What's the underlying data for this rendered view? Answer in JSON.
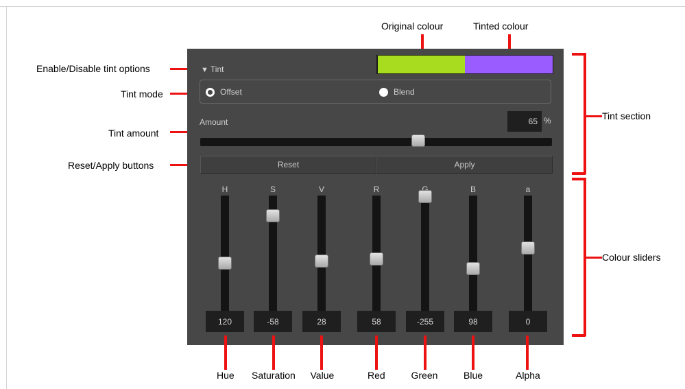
{
  "callouts": {
    "enable_disable": "Enable/Disable tint options",
    "tint_mode": "Tint mode",
    "tint_amount": "Tint  amount",
    "reset_apply": "Reset/Apply buttons",
    "original_colour": "Original colour",
    "tinted_colour": "Tinted colour",
    "tint_section": "Tint section",
    "colour_sliders": "Colour sliders"
  },
  "panel": {
    "tint_label": "Tint",
    "original_swatch_color": "#a8dc1e",
    "tinted_swatch_color": "#9b5cff",
    "mode_offset": "Offset",
    "mode_blend": "Blend",
    "selected_mode": "Offset",
    "amount_label": "Amount",
    "amount_value": "65",
    "amount_unit": "%",
    "amount_fraction": 0.65,
    "reset_label": "Reset",
    "apply_label": "Apply"
  },
  "sliders": [
    {
      "label": "H",
      "value": "120",
      "level": 0.38,
      "caption": "Hue"
    },
    {
      "label": "S",
      "value": "-58",
      "level": 0.82,
      "caption": "Saturation"
    },
    {
      "label": "V",
      "value": "28",
      "level": 0.4,
      "caption": "Value"
    },
    {
      "label": "R",
      "value": "58",
      "level": 0.42,
      "caption": "Red"
    },
    {
      "label": "G",
      "value": "-255",
      "level": 1.0,
      "caption": "Green"
    },
    {
      "label": "B",
      "value": "98",
      "level": 0.33,
      "caption": "Blue"
    },
    {
      "label": "a",
      "value": "0",
      "level": 0.52,
      "caption": "Alpha"
    }
  ],
  "colors": {
    "accent": "#ee1111",
    "panel_bg": "#474747"
  }
}
